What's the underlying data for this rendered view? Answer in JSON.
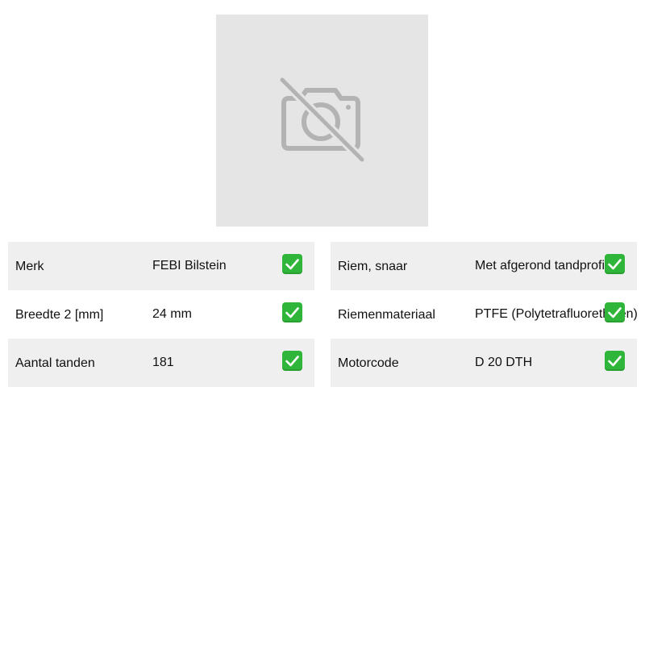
{
  "product_image": {
    "icon": "no-photo-icon",
    "background_color": "#e5e5e5",
    "icon_color": "#b3b3b3"
  },
  "specs": {
    "left": [
      {
        "label": "Merk",
        "value": "FEBI Bilstein",
        "status_icon": "check-icon"
      },
      {
        "label": "Breedte 2 [mm]",
        "value": "24 mm",
        "status_icon": "check-icon"
      },
      {
        "label": "Aantal tanden",
        "value": "181",
        "status_icon": "check-icon"
      }
    ],
    "right": [
      {
        "label": "Riem, snaar",
        "value": "Met afgerond tandprofiel",
        "status_icon": "check-icon"
      },
      {
        "label": "Riemenmateriaal",
        "value": "PTFE (Polytetrafluorethylen)",
        "status_icon": "check-icon"
      },
      {
        "label": "Motorcode",
        "value": "D 20 DTH",
        "status_icon": "check-icon"
      }
    ]
  },
  "colors": {
    "row_shaded": "#efefef",
    "check_green": "#2fb63a"
  }
}
